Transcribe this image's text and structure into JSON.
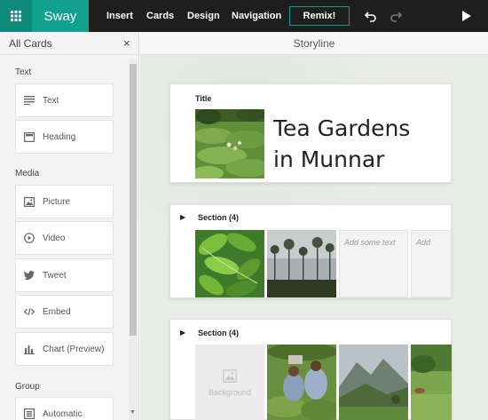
{
  "app": {
    "brand": "Sway"
  },
  "menu": {
    "insert": "Insert",
    "cards": "Cards",
    "design": "Design",
    "navigation": "Navigation",
    "remix": "Remix!"
  },
  "toolbar_icons": [
    "app-grid-icon",
    "undo-icon",
    "redo-icon",
    "play-icon"
  ],
  "cards_panel": {
    "title": "All Cards",
    "close": "×",
    "groups": {
      "text": "Text",
      "media": "Media",
      "group": "Group"
    },
    "items": {
      "text": "Text",
      "heading": "Heading",
      "picture": "Picture",
      "video": "Video",
      "tweet": "Tweet",
      "embed": "Embed",
      "chart": "Chart (Preview)",
      "automatic": "Automatic"
    }
  },
  "storyline": {
    "header": "Storyline",
    "title_card": {
      "label": "Title",
      "text_line1": "Tea Gardens",
      "text_line2": "in Munnar"
    },
    "section1": {
      "label": "Section (4)",
      "text_placeholder": "Add some text",
      "text_placeholder_2": "Add"
    },
    "section2": {
      "label": "Section (4)",
      "background_label": "Background"
    }
  },
  "colors": {
    "accent": "#12a18f",
    "accent_dark": "#0f8a7a",
    "topbar": "#1e1e1e"
  }
}
